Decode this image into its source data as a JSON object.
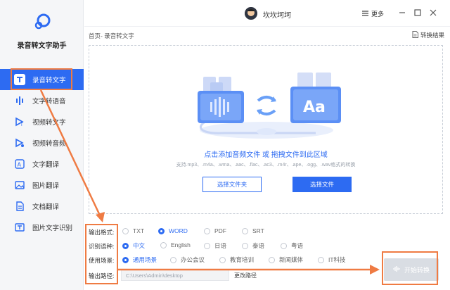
{
  "app": {
    "name": "录音转文字助手"
  },
  "sidebar": {
    "items": [
      {
        "label": "录音转文字",
        "icon": "text-t-icon",
        "active": true
      },
      {
        "label": "文字转语音",
        "icon": "audio-wave-icon",
        "active": false
      },
      {
        "label": "视频转文字",
        "icon": "video-text-icon",
        "active": false
      },
      {
        "label": "视频转音频",
        "icon": "video-audio-icon",
        "active": false
      },
      {
        "label": "文字翻译",
        "icon": "translate-icon",
        "active": false
      },
      {
        "label": "图片翻译",
        "icon": "image-translate-icon",
        "active": false
      },
      {
        "label": "文档翻译",
        "icon": "document-translate-icon",
        "active": false
      },
      {
        "label": "图片文字识别",
        "icon": "ocr-icon",
        "active": false
      }
    ]
  },
  "titlebar": {
    "username": "坎坎坷坷",
    "more_label": "更多"
  },
  "breadcrumb": "首页- 录音转文字",
  "results_link": "转换结果",
  "dropzone": {
    "main_text": "点击添加音频文件 或 拖拽文件到此区域",
    "hint_text": "支持.mp3、.m4a、.wma、.aac、.flac、.ac3、.m4r、.ape、.ogg、.wav格式的转换",
    "illustration_text": "Aa",
    "select_folder_label": "选择文件夹",
    "select_file_label": "选择文件"
  },
  "settings": {
    "output_format": {
      "label": "输出格式:",
      "options": [
        "TXT",
        "WORD",
        "PDF",
        "SRT"
      ],
      "selected": "WORD"
    },
    "language": {
      "label": "识别语种:",
      "options": [
        "中文",
        "English",
        "日语",
        "泰语",
        "粤语"
      ],
      "selected": "中文"
    },
    "scene": {
      "label": "使用场景:",
      "options": [
        "通用场景",
        "办公会议",
        "教育培训",
        "新闻媒体",
        "IT科技"
      ],
      "selected": "通用场景"
    },
    "output_path": {
      "label": "输出路径:",
      "value": "C:\\Users\\Admin\\desktop",
      "change_label": "更改路径"
    }
  },
  "start_button": {
    "label": "开始转换"
  },
  "colors": {
    "accent": "#2d6bf2",
    "annotation": "#ef7b43",
    "sidebar_bg": "#f5f6f8"
  }
}
